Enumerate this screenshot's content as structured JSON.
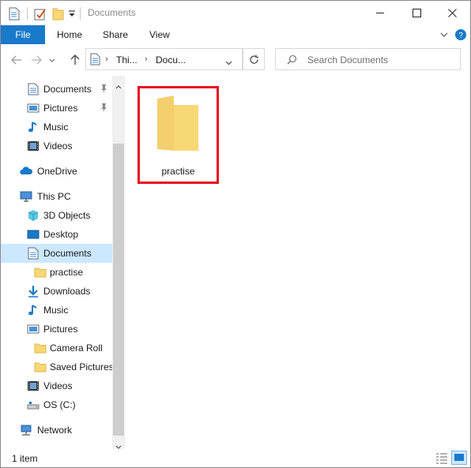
{
  "window": {
    "title": "Documents",
    "controls": [
      "minimize-icon",
      "maximize-icon",
      "close-icon"
    ]
  },
  "ribbon": {
    "file_label": "File",
    "tabs": [
      "Home",
      "Share",
      "View"
    ]
  },
  "address": {
    "breadcrumbs": [
      "Thi...",
      "Docu..."
    ],
    "search_placeholder": "Search Documents"
  },
  "nav": {
    "items": [
      {
        "label": "Documents",
        "icon": "documents-icon",
        "pinned": true
      },
      {
        "label": "Pictures",
        "icon": "pictures-icon",
        "pinned": true
      },
      {
        "label": "Music",
        "icon": "music-icon"
      },
      {
        "label": "Videos",
        "icon": "videos-icon"
      },
      {
        "label": "OneDrive",
        "icon": "onedrive-icon"
      },
      {
        "label": "This PC",
        "icon": "this-pc-icon"
      },
      {
        "label": "3D Objects",
        "icon": "3d-objects-icon"
      },
      {
        "label": "Desktop",
        "icon": "desktop-icon"
      },
      {
        "label": "Documents",
        "icon": "documents-icon",
        "selected": true
      },
      {
        "label": "practise",
        "icon": "folder-icon"
      },
      {
        "label": "Downloads",
        "icon": "downloads-icon"
      },
      {
        "label": "Music",
        "icon": "music-icon"
      },
      {
        "label": "Pictures",
        "icon": "pictures-icon"
      },
      {
        "label": "Camera Roll",
        "icon": "folder-icon"
      },
      {
        "label": "Saved Pictures",
        "icon": "folder-icon"
      },
      {
        "label": "Videos",
        "icon": "videos-icon"
      },
      {
        "label": "OS (C:)",
        "icon": "drive-icon"
      },
      {
        "label": "Network",
        "icon": "network-icon"
      }
    ]
  },
  "content": {
    "items": [
      {
        "name": "practise",
        "icon": "folder-icon",
        "highlighted": true
      }
    ]
  },
  "status": {
    "item_count": "1 item"
  },
  "colors": {
    "accent": "#1979ca",
    "selection": "#cce8ff",
    "highlight_border": "#e81123",
    "folder": "#f8d775"
  }
}
